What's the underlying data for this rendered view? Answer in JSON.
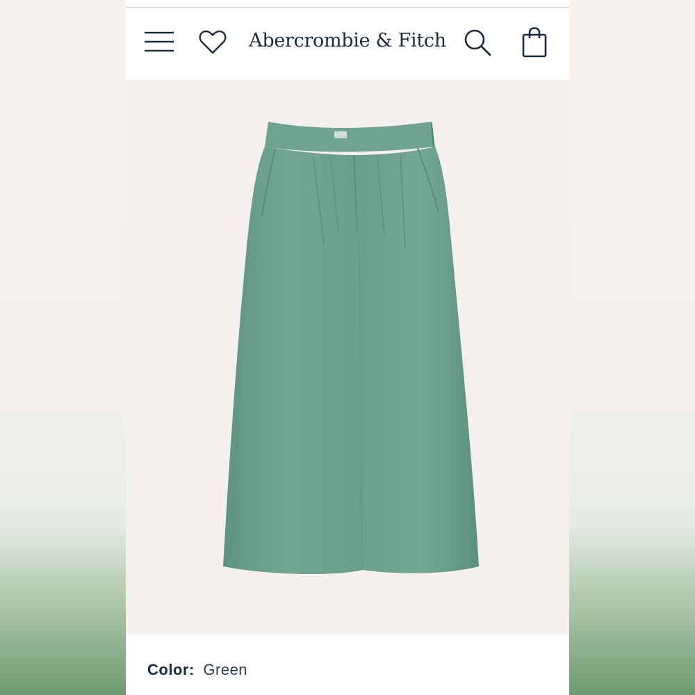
{
  "brand": {
    "logo_text": "Abercrombie & Fitch"
  },
  "header": {
    "icons": [
      "menu-icon",
      "heart-icon",
      "search-icon",
      "bag-icon"
    ]
  },
  "product": {
    "image_name": "pants-image",
    "image_color": "#6fa293",
    "color_label": "Color:",
    "color_value": "Green"
  },
  "colors": {
    "brand_navy": "#1c2a3e",
    "backdrop_green": "#6e9a70",
    "product_bg": "#f4f0ee"
  }
}
